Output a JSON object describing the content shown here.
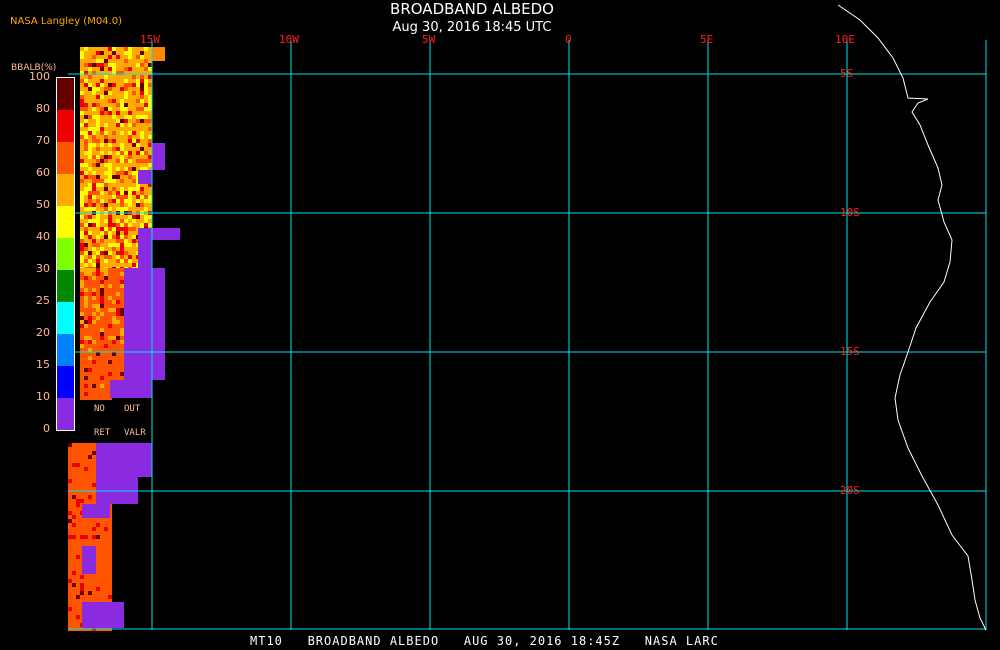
{
  "header": {
    "title": "BROADBAND ALBEDO",
    "subtitle": "Aug 30, 2016 18:45 UTC",
    "source": "NASA Langley (M04.0)"
  },
  "colorbar": {
    "title": "BBALB(%)",
    "labels": [
      "100",
      "80",
      "70",
      "60",
      "50",
      "40",
      "30",
      "25",
      "20",
      "15",
      "10",
      "0"
    ],
    "colors": [
      "#660000",
      "#ee0000",
      "#ff5500",
      "#ffaa00",
      "#ffff00",
      "#80ff00",
      "#008800",
      "#00ffff",
      "#0080ff",
      "#0000ff",
      "#8a2be2"
    ],
    "no_ret": [
      "NO",
      "RET"
    ],
    "out_valr": [
      "OUT",
      "VALR"
    ]
  },
  "map": {
    "longitude_labels": [
      "15W",
      "10W",
      "5W",
      "0",
      "5E",
      "10E"
    ],
    "latitude_labels": [
      "5S",
      "10S",
      "15S",
      "20S"
    ],
    "grid_color": "#00e5ee",
    "coast_color": "#ffffff"
  },
  "footer": "MT10   BROADBAND ALBEDO   AUG 30, 2016 18:45Z   NASA LARC"
}
